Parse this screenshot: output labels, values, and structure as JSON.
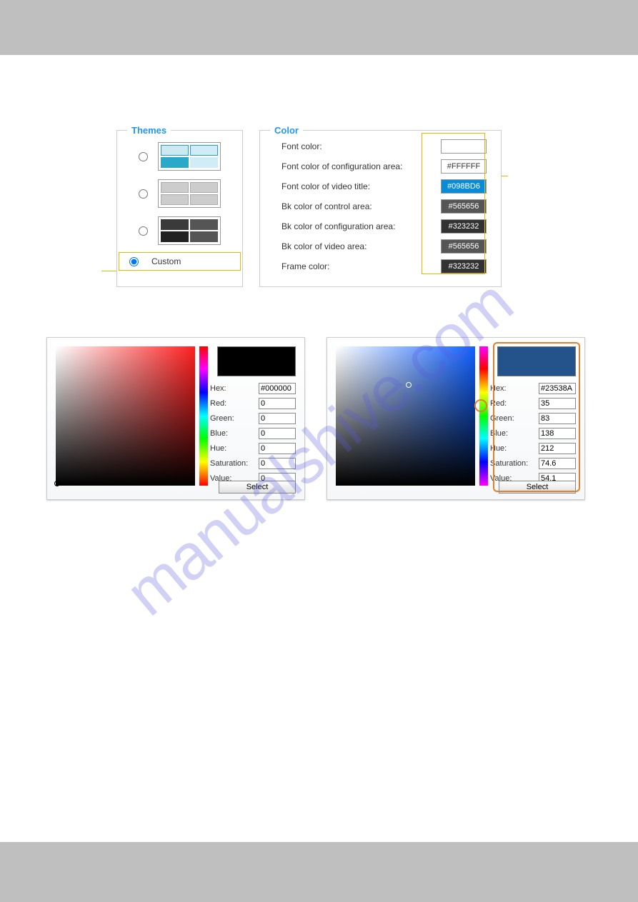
{
  "watermark": "manualshive.com",
  "themes": {
    "legend": "Themes",
    "custom_label": "Custom"
  },
  "color": {
    "legend": "Color",
    "rows": [
      {
        "label": "Font color:",
        "value": "",
        "bg": "#ffffff",
        "fg": "#000"
      },
      {
        "label": "Font color of configuration area:",
        "value": "#FFFFFF",
        "bg": "#ffffff",
        "fg": "#333"
      },
      {
        "label": "Font color of video title:",
        "value": "#098BD6",
        "bg": "#098BD6",
        "fg": "#fff"
      },
      {
        "label": "Bk color of control area:",
        "value": "#565656",
        "bg": "#565656",
        "fg": "#fff"
      },
      {
        "label": "Bk color of configuration area:",
        "value": "#323232",
        "bg": "#323232",
        "fg": "#fff"
      },
      {
        "label": "Bk color of video area:",
        "value": "#565656",
        "bg": "#565656",
        "fg": "#fff"
      },
      {
        "label": "Frame color:",
        "value": "#323232",
        "bg": "#323232",
        "fg": "#fff"
      }
    ]
  },
  "pickerLabels": {
    "hex": "Hex:",
    "red": "Red:",
    "green": "Green:",
    "blue": "Blue:",
    "hue": "Hue:",
    "saturation": "Saturation:",
    "value": "Value:",
    "select": "Select"
  },
  "picker1": {
    "preview": "#000000",
    "hex": "#000000",
    "red": "0",
    "green": "0",
    "blue": "0",
    "hue": "0",
    "saturation": "0",
    "value": "0",
    "gradient_hue": "#ff2020"
  },
  "picker2": {
    "preview": "#23538A",
    "hex": "#23538A",
    "red": "35",
    "green": "83",
    "blue": "138",
    "hue": "212",
    "saturation": "74.6",
    "value": "54.1",
    "gradient_hue": "#1060ff"
  }
}
